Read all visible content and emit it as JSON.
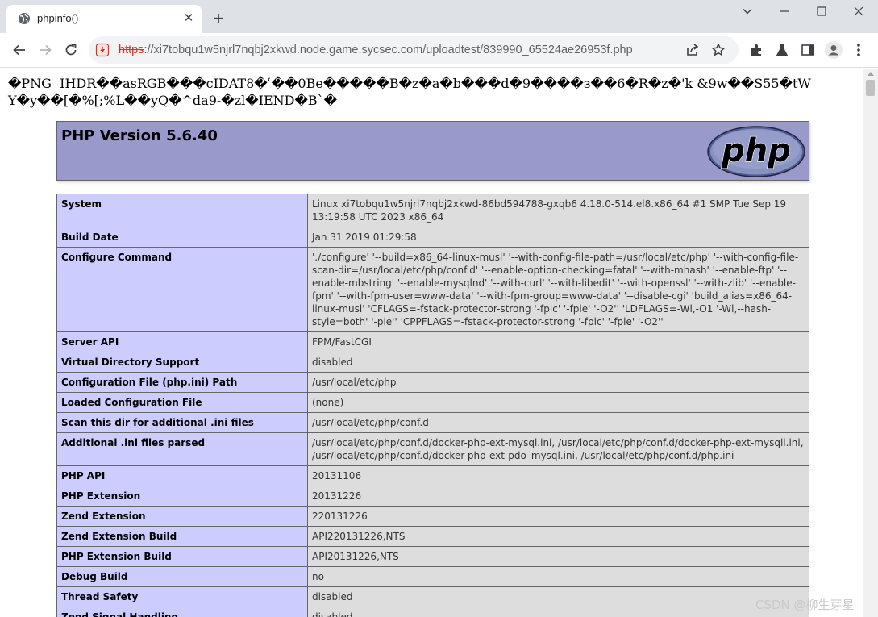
{
  "browser": {
    "tab_title": "phpinfo()",
    "url_scheme": "https",
    "url_rest": "://xi7tobqu1w5njrl7nqbj2xkwd.node.game.sycsec.com/uploadtest/839990_65524ae26953f.php"
  },
  "page": {
    "garbage_text": "�PNG \u0001 IHDR\u0001\u0001\u0001\u0001\u0001\u0001��a\u0001sRGB���\u0001cIDAT8�ʿ��0\u0001Be�����B�z�a�b\u0001��\u0001\u0001�d\u0001�9���\u0001�з��6\u0001�\u0001R�\u0001\u0001z\u0001\u0001�'k &9\u0001w��S55�\u0001t\u0001WY�y��[\u0001\u0001�%[;%L��yQ\u0001�\u0001^da9-�zl�IEND�B`�",
    "php_version": "PHP Version 5.6.40",
    "logo_text": "php",
    "rows": [
      {
        "key": "System",
        "value": "Linux xi7tobqu1w5njrl7nqbj2xkwd-86bd594788-gxqb6 4.18.0-514.el8.x86_64 #1 SMP Tue Sep 19 13:19:58 UTC 2023 x86_64"
      },
      {
        "key": "Build Date",
        "value": "Jan 31 2019 01:29:58"
      },
      {
        "key": "Configure Command",
        "value": "'./configure' '--build=x86_64-linux-musl' '--with-config-file-path=/usr/local/etc/php' '--with-config-file-scan-dir=/usr/local/etc/php/conf.d' '--enable-option-checking=fatal' '--with-mhash' '--enable-ftp' '--enable-mbstring' '--enable-mysqlnd' '--with-curl' '--with-libedit' '--with-openssl' '--with-zlib' '--enable-fpm' '--with-fpm-user=www-data' '--with-fpm-group=www-data' '--disable-cgi' 'build_alias=x86_64-linux-musl' 'CFLAGS=-fstack-protector-strong '-fpic' '-fpie' '-O2'' 'LDFLAGS=-Wl,-O1 '-Wl,--hash-style=both' '-pie'' 'CPPFLAGS=-fstack-protector-strong '-fpic' '-fpie' '-O2''"
      },
      {
        "key": "Server API",
        "value": "FPM/FastCGI"
      },
      {
        "key": "Virtual Directory Support",
        "value": "disabled"
      },
      {
        "key": "Configuration File (php.ini) Path",
        "value": "/usr/local/etc/php"
      },
      {
        "key": "Loaded Configuration File",
        "value": "(none)"
      },
      {
        "key": "Scan this dir for additional .ini files",
        "value": "/usr/local/etc/php/conf.d"
      },
      {
        "key": "Additional .ini files parsed",
        "value": "/usr/local/etc/php/conf.d/docker-php-ext-mysql.ini, /usr/local/etc/php/conf.d/docker-php-ext-mysqli.ini, /usr/local/etc/php/conf.d/docker-php-ext-pdo_mysql.ini, /usr/local/etc/php/conf.d/php.ini"
      },
      {
        "key": "PHP API",
        "value": "20131106"
      },
      {
        "key": "PHP Extension",
        "value": "20131226"
      },
      {
        "key": "Zend Extension",
        "value": "220131226"
      },
      {
        "key": "Zend Extension Build",
        "value": "API220131226,NTS"
      },
      {
        "key": "PHP Extension Build",
        "value": "API20131226,NTS"
      },
      {
        "key": "Debug Build",
        "value": "no"
      },
      {
        "key": "Thread Safety",
        "value": "disabled"
      },
      {
        "key": "Zend Signal Handling",
        "value": "disabled"
      }
    ]
  },
  "watermark": "CSDN @柳生芽星",
  "colors": {
    "header_bg": "#9999cc",
    "key_bg": "#ccccff",
    "value_bg": "#dddddd",
    "insecure_scheme": "#d93025"
  }
}
